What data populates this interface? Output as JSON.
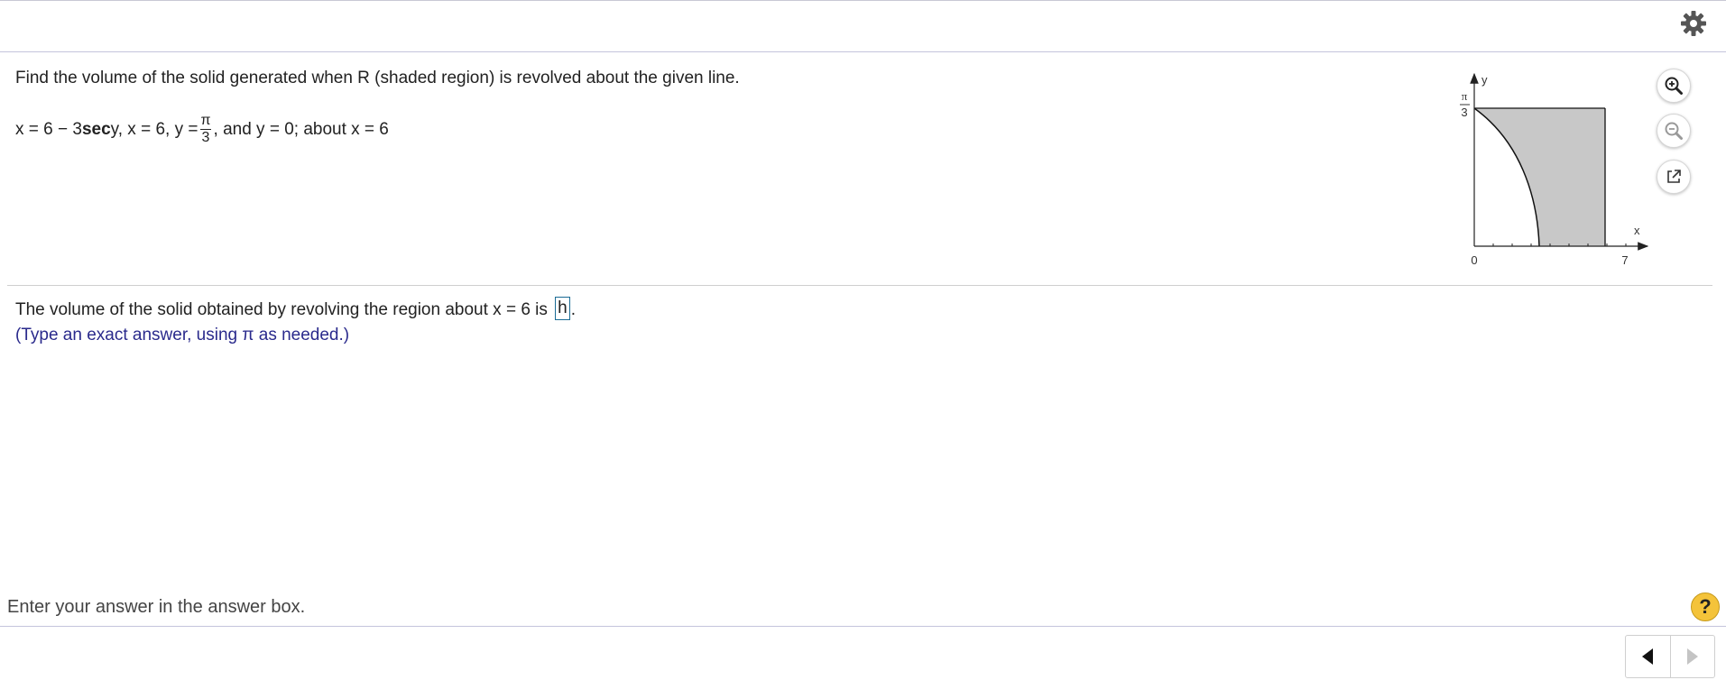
{
  "header": {
    "settings_icon": "gear-icon"
  },
  "problem": {
    "question": "Find the volume of the solid generated when R (shaded region) is revolved about the given line.",
    "equation": {
      "part1": "x = 6 − 3 ",
      "sec": "sec",
      "part2": " y, x = 6, y = ",
      "frac_num": "π",
      "frac_den": "3",
      "part3": ", and y = 0; about x = 6"
    }
  },
  "graph": {
    "y_label": "y",
    "x_label": "x",
    "y_tick_num": "π",
    "y_tick_den": "3",
    "x_tick_0": "0",
    "x_tick_end": "7",
    "fill_color": "#c8c8c8"
  },
  "tools": {
    "zoom_in_icon": "zoom-in-icon",
    "zoom_out_icon": "zoom-out-icon",
    "popout_icon": "external-link-icon"
  },
  "answer": {
    "prefix": "The volume of the solid obtained by revolving the region about x = 6 is ",
    "value": "h",
    "suffix": ".",
    "hint": "(Type an exact answer, using π as needed.)"
  },
  "footer": {
    "instruction": "Enter your answer in the answer box.",
    "help_label": "?"
  },
  "colors": {
    "accent": "#1a6b94",
    "hint": "#2a2a8c",
    "help": "#f4c33a"
  }
}
